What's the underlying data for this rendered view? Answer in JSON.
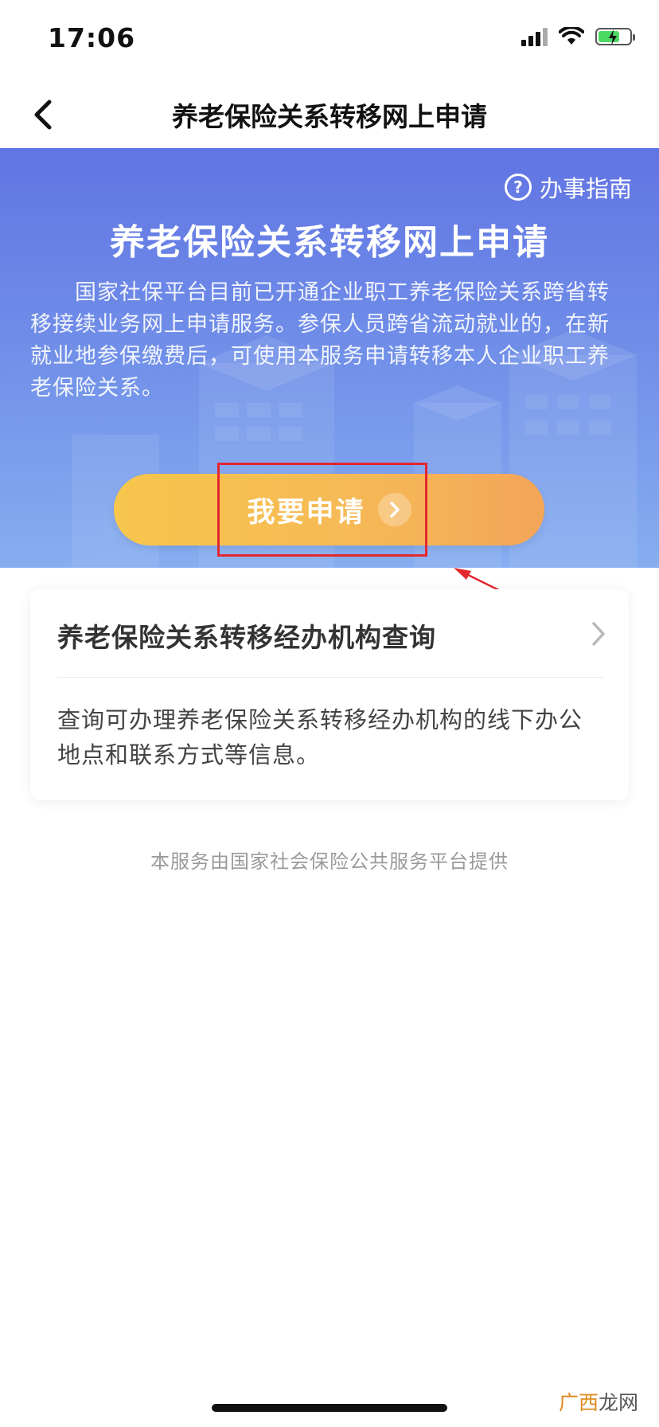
{
  "status_bar": {
    "time": "17:06",
    "battery_charging": true
  },
  "nav": {
    "title": "养老保险关系转移网上申请"
  },
  "banner": {
    "guide_label": "办事指南",
    "title": "养老保险关系转移网上申请",
    "description": "国家社保平台目前已开通企业职工养老保险关系跨省转移接续业务网上申请服务。参保人员跨省流动就业的，在新就业地参保缴费后，可使用本服务申请转移本人企业职工养老保险关系。",
    "apply_label": "我要申请"
  },
  "card": {
    "title": "养老保险关系转移经办机构查询",
    "description": "查询可办理养老保险关系转移经办机构的线下办公地点和联系方式等信息。"
  },
  "footer": {
    "note": "本服务由国家社会保险公共服务平台提供"
  },
  "watermark": {
    "part1": "广西",
    "part2": "龙网"
  },
  "colors": {
    "banner_top": "#6174e3",
    "banner_bottom": "#86aef0",
    "apply_button": "#f6b857",
    "annotation_red": "#e4262e"
  },
  "icons": {
    "back": "chevron-left-icon",
    "guide": "question-circle-icon",
    "apply": "chevron-right-circle-icon",
    "card": "chevron-right-icon"
  }
}
